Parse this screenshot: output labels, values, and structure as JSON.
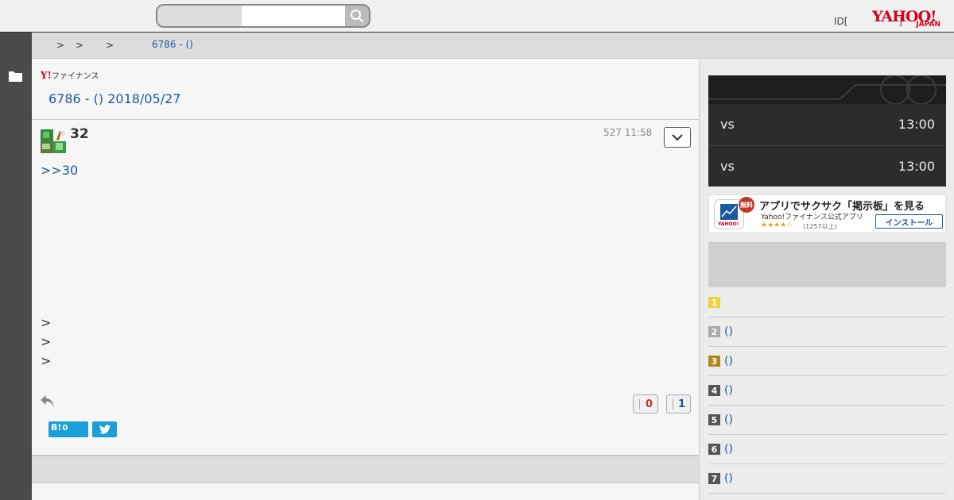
{
  "header": {
    "search_placeholder": "",
    "search_value": "",
    "id_link": "ID[",
    "id_bracket_close": "]",
    "logo_main": "YAHOO!",
    "logo_sub": "JAPAN"
  },
  "breadcrumb": {
    "sep1": ">",
    "sep2": ">",
    "sep3": ">",
    "current": "6786 - ()"
  },
  "thread": {
    "logo_y": "Y!",
    "logo_text": "ファイナンス",
    "title": "6786 - () 2018/05/27"
  },
  "post": {
    "number": "32",
    "time": "527 11:58",
    "reply_anchor": ">>30",
    "arrow_lines": [
      ">",
      ">",
      ">"
    ],
    "like_count": "0",
    "dislike_count": "1",
    "hatena_label": "B!",
    "hatena_count": "0"
  },
  "sidebar": {
    "games": [
      {
        "vs": "vs",
        "time": "13:00"
      },
      {
        "vs": "vs",
        "time": "13:00"
      }
    ],
    "app_banner": {
      "free_badge": "無料",
      "title": "アプリでサクサク「掲示板」を見る",
      "subtitle": "Yahoo!ファイナンス公式アプリ",
      "stars": "★★★★☆",
      "rating_count": "(1257以上)",
      "install_label": "インストール",
      "icon_text": "YAHOO!"
    },
    "ranking": [
      {
        "rank": "1",
        "label": "",
        "color": "#f2d03c"
      },
      {
        "rank": "2",
        "label": "()",
        "color": "#aaaaaa"
      },
      {
        "rank": "3",
        "label": "()",
        "color": "#a88a1c"
      },
      {
        "rank": "4",
        "label": "()",
        "color": "#555555"
      },
      {
        "rank": "5",
        "label": "()",
        "color": "#555555"
      },
      {
        "rank": "6",
        "label": "()",
        "color": "#555555"
      },
      {
        "rank": "7",
        "label": "()",
        "color": "#555555"
      }
    ]
  },
  "colors": {
    "link": "#1a5a9e",
    "brand_red": "#d6001c",
    "share_blue": "#1a9fd8"
  }
}
